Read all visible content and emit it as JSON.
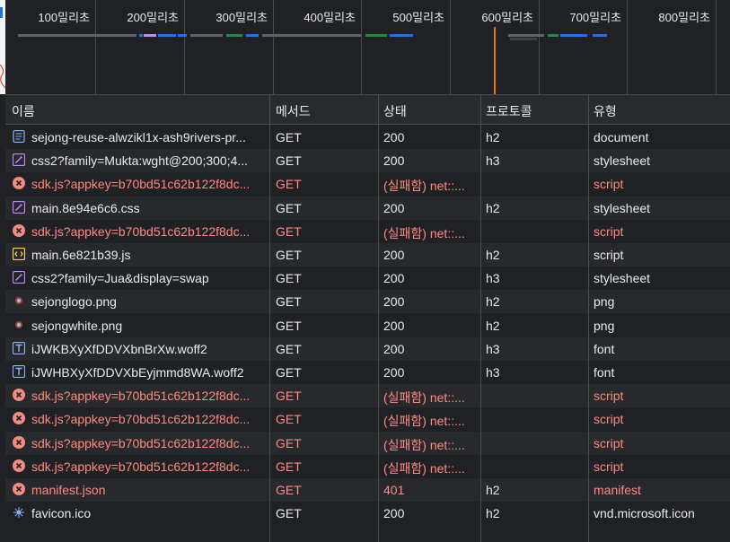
{
  "overview": {
    "ticks": [
      "100밀리초",
      "200밀리초",
      "300밀리초",
      "400밀리초",
      "500밀리초",
      "600밀리초",
      "700밀리초",
      "800밀리초"
    ]
  },
  "columns": {
    "name": "이름",
    "method": "메서드",
    "status": "상태",
    "protocol": "프로토콜",
    "type": "유형"
  },
  "rows": [
    {
      "name": "sejong-reuse-alwzikl1x-ash9rivers-pr...",
      "method": "GET",
      "status": "200",
      "protocol": "h2",
      "type": "document",
      "icon": "document-icon",
      "error": false
    },
    {
      "name": "css2?family=Mukta:wght@200;300;4...",
      "method": "GET",
      "status": "200",
      "protocol": "h3",
      "type": "stylesheet",
      "icon": "stylesheet-icon",
      "error": false
    },
    {
      "name": "sdk.js?appkey=b70bd51c62b122f8dc...",
      "method": "GET",
      "status": "(실패함) net::...",
      "protocol": "",
      "type": "script",
      "icon": "error-icon",
      "error": true
    },
    {
      "name": "main.8e94e6c6.css",
      "method": "GET",
      "status": "200",
      "protocol": "h2",
      "type": "stylesheet",
      "icon": "stylesheet-icon",
      "error": false
    },
    {
      "name": "sdk.js?appkey=b70bd51c62b122f8dc...",
      "method": "GET",
      "status": "(실패함) net::...",
      "protocol": "",
      "type": "script",
      "icon": "error-icon",
      "error": true
    },
    {
      "name": "main.6e821b39.js",
      "method": "GET",
      "status": "200",
      "protocol": "h2",
      "type": "script",
      "icon": "script-icon",
      "error": false
    },
    {
      "name": "css2?family=Jua&display=swap",
      "method": "GET",
      "status": "200",
      "protocol": "h3",
      "type": "stylesheet",
      "icon": "stylesheet-icon",
      "error": false
    },
    {
      "name": "sejonglogo.png",
      "method": "GET",
      "status": "200",
      "protocol": "h2",
      "type": "png",
      "icon": "image-thumbnail-icon",
      "error": false
    },
    {
      "name": "sejongwhite.png",
      "method": "GET",
      "status": "200",
      "protocol": "h2",
      "type": "png",
      "icon": "image-thumbnail-icon",
      "error": false
    },
    {
      "name": "iJWKBXyXfDDVXbnBrXw.woff2",
      "method": "GET",
      "status": "200",
      "protocol": "h3",
      "type": "font",
      "icon": "font-icon",
      "error": false
    },
    {
      "name": "iJWHBXyXfDDVXbEyjmmd8WA.woff2",
      "method": "GET",
      "status": "200",
      "protocol": "h3",
      "type": "font",
      "icon": "font-icon",
      "error": false
    },
    {
      "name": "sdk.js?appkey=b70bd51c62b122f8dc...",
      "method": "GET",
      "status": "(실패함) net::...",
      "protocol": "",
      "type": "script",
      "icon": "error-icon",
      "error": true
    },
    {
      "name": "sdk.js?appkey=b70bd51c62b122f8dc...",
      "method": "GET",
      "status": "(실패함) net::...",
      "protocol": "",
      "type": "script",
      "icon": "error-icon",
      "error": true
    },
    {
      "name": "sdk.js?appkey=b70bd51c62b122f8dc...",
      "method": "GET",
      "status": "(실패함) net::...",
      "protocol": "",
      "type": "script",
      "icon": "error-icon",
      "error": true
    },
    {
      "name": "sdk.js?appkey=b70bd51c62b122f8dc...",
      "method": "GET",
      "status": "(실패함) net::...",
      "protocol": "",
      "type": "script",
      "icon": "error-icon",
      "error": true
    },
    {
      "name": "manifest.json",
      "method": "GET",
      "status": "401",
      "protocol": "h2",
      "type": "manifest",
      "icon": "error-icon",
      "error": true
    },
    {
      "name": "favicon.ico",
      "method": "GET",
      "status": "200",
      "protocol": "h2",
      "type": "vnd.microsoft.icon",
      "icon": "favicon-icon",
      "error": false
    }
  ],
  "colors": {
    "error": "#ff8a80",
    "background": "#202124",
    "grid": "#494c50",
    "marker": "#e8710a"
  }
}
